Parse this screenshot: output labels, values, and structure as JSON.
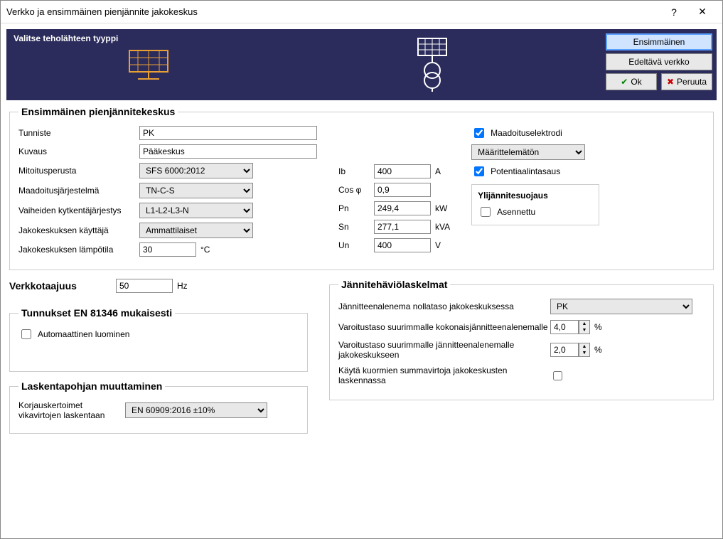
{
  "window": {
    "title": "Verkko ja ensimmäinen pienjännite jakokeskus"
  },
  "banner": {
    "title": "Valitse teholähteen tyyppi",
    "btn_first": "Ensimmäinen",
    "btn_prev": "Edeltävä verkko",
    "btn_ok": "Ok",
    "btn_cancel": "Peruuta"
  },
  "section1": {
    "legend": "Ensimmäinen pienjännitekeskus",
    "tunniste_lbl": "Tunniste",
    "tunniste": "PK",
    "kuvaus_lbl": "Kuvaus",
    "kuvaus": "Pääkeskus",
    "mitoitus_lbl": "Mitoitusperusta",
    "mitoitus": "SFS 6000:2012",
    "maadoitus_lbl": "Maadoitusjärjestelmä",
    "maadoitus": "TN-C-S",
    "vaihe_lbl": "Vaiheiden kytkentäjärjestys",
    "vaihe": "L1-L2-L3-N",
    "kayttaja_lbl": "Jakokeskuksen käyttäjä",
    "kayttaja": "Ammattilaiset",
    "lampo_lbl": "Jakokeskuksen lämpötila",
    "lampo": "30",
    "lampo_unit": "°C",
    "ib_lbl": "Ib",
    "ib": "400",
    "ib_unit": "A",
    "cos_lbl": "Cos φ",
    "cos": "0,9",
    "pn_lbl": "Pn",
    "pn": "249,4",
    "pn_unit": "kW",
    "sn_lbl": "Sn",
    "sn": "277,1",
    "sn_unit": "kVA",
    "un_lbl": "Un",
    "un": "400",
    "un_unit": "V",
    "maad_elektrodi": "Maadoituselektrodi",
    "maarit": "Määrittelemätön",
    "potent": "Potentiaalintasaus",
    "yli_legend": "Ylijännitesuojaus",
    "asennettu": "Asennettu"
  },
  "freq": {
    "lbl": "Verkkotaajuus",
    "val": "50",
    "unit": "Hz"
  },
  "tunnukset": {
    "legend": "Tunnukset EN 81346 mukaisesti",
    "auto": "Automaattinen luominen"
  },
  "laskenta": {
    "legend": "Laskentapohjan muuttaminen",
    "korj_lbl": "Korjauskertoimet vikavirtojen laskentaan",
    "korj": "EN 60909:2016 ±10%"
  },
  "jannite": {
    "legend": "Jännitehäviölaskelmat",
    "nolla_lbl": "Jännitteenalenema nollataso jakokeskuksessa",
    "nolla": "PK",
    "varo1_lbl": "Varoitustaso suurimmalle kokonaisjännitteenalenemalle",
    "varo1": "4,0",
    "varo2_lbl": "Varoitustaso suurimmalle jännitteenalenemalle jakokeskukseen",
    "varo2": "2,0",
    "summa_lbl": "Käytä kuormien summavirtoja jakokeskusten laskennassa",
    "pct": "%"
  }
}
